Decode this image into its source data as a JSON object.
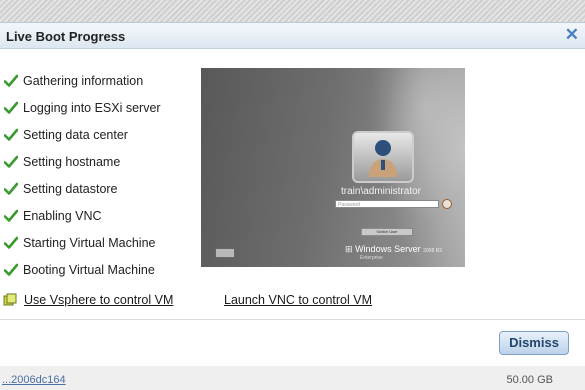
{
  "dialog": {
    "title": "Live Boot Progress",
    "close_icon": "close-icon",
    "steps": [
      {
        "label": "Gathering information",
        "status_icon": "check-icon"
      },
      {
        "label": "Logging into ESXi server",
        "status_icon": "check-icon"
      },
      {
        "label": "Setting data center",
        "status_icon": "check-icon"
      },
      {
        "label": "Setting hostname",
        "status_icon": "check-icon"
      },
      {
        "label": "Setting datastore",
        "status_icon": "check-icon"
      },
      {
        "label": "Enabling VNC",
        "status_icon": "check-icon"
      },
      {
        "label": "Starting Virtual Machine",
        "status_icon": "check-icon"
      },
      {
        "label": "Booting Virtual Machine",
        "status_icon": "check-icon"
      }
    ],
    "vm_screen": {
      "username": "train\\administrator",
      "password_placeholder": "Password",
      "switch_user_label": "Switch User",
      "os_brand": "Windows Server",
      "os_version": "2008 R2",
      "os_edition": "Enterprise"
    },
    "vsphere_link": "Use Vsphere to control VM",
    "vnc_link": "Launch VNC to control VM",
    "dismiss_label": "Dismiss"
  },
  "background": {
    "link_text": "...2006dc164",
    "size_text": "50.00 GB"
  },
  "colors": {
    "check_green": "#3a9a2e",
    "title_bar": "#dde7f1",
    "link_blue": "#4a6fa5",
    "dismiss_border": "#7ea3c8"
  }
}
